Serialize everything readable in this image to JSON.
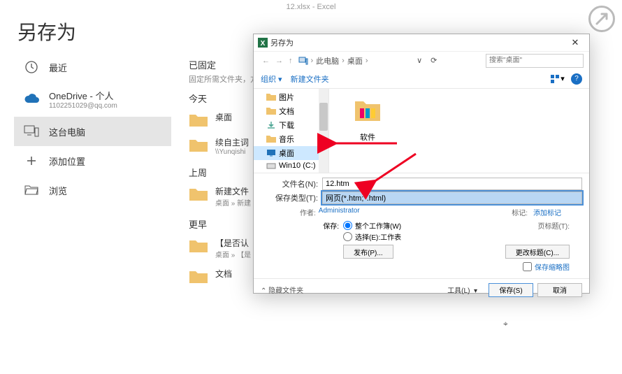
{
  "titlebar": "12.xlsx  -  Excel",
  "page_title": "另存为",
  "sidebar": {
    "recent": "最近",
    "onedrive": {
      "label": "OneDrive - 个人",
      "sub": "1102251029@qq.com"
    },
    "this_pc": "这台电脑",
    "add_place": "添加位置",
    "browse": "浏览"
  },
  "main": {
    "pinned_head": "已固定",
    "pinned_sub": "固定所需文件夹，方",
    "today": "今天",
    "desktop": "桌面",
    "xuzi": {
      "label": "续自主词",
      "sub": "\\\\Yunqishi"
    },
    "lastweek": "上周",
    "newfolder": {
      "label": "新建文件",
      "sub": "桌面 » 新建"
    },
    "earlier": "更早",
    "shifou": {
      "label": "【是否认",
      "sub": "桌面 » 【是"
    },
    "docs": "文档"
  },
  "dialog": {
    "title": "另存为",
    "path": {
      "seg1": "此电脑",
      "seg2": "桌面"
    },
    "search_placeholder": "搜索\"桌面\"",
    "toolbar": {
      "organize": "组织",
      "newfolder": "新建文件夹"
    },
    "tree": {
      "pictures": "图片",
      "documents": "文档",
      "downloads": "下载",
      "music": "音乐",
      "desktop": "桌面",
      "win10c": "Win10 (C:)"
    },
    "fileview": {
      "software": "软件"
    },
    "form": {
      "filename_label": "文件名(N):",
      "filename": "12.htm",
      "type_label": "保存类型(T):",
      "type": "网页(*.htm;*.html)",
      "author_label": "作者:",
      "author": "Administrator",
      "tag_label": "标记:",
      "tag": "添加标记",
      "save_label": "保存:",
      "whole_workbook": "整个工作簿(W)",
      "selected_sheet": "选择(E):工作表",
      "pagetitle_label": "页标题(T):",
      "publish": "发布(P)...",
      "change_title": "更改标题(C)...",
      "save_thumb": "保存缩略图"
    },
    "footer": {
      "hide": "隐藏文件夹",
      "tools": "工具(L)",
      "save": "保存(S)",
      "cancel": "取消"
    }
  }
}
